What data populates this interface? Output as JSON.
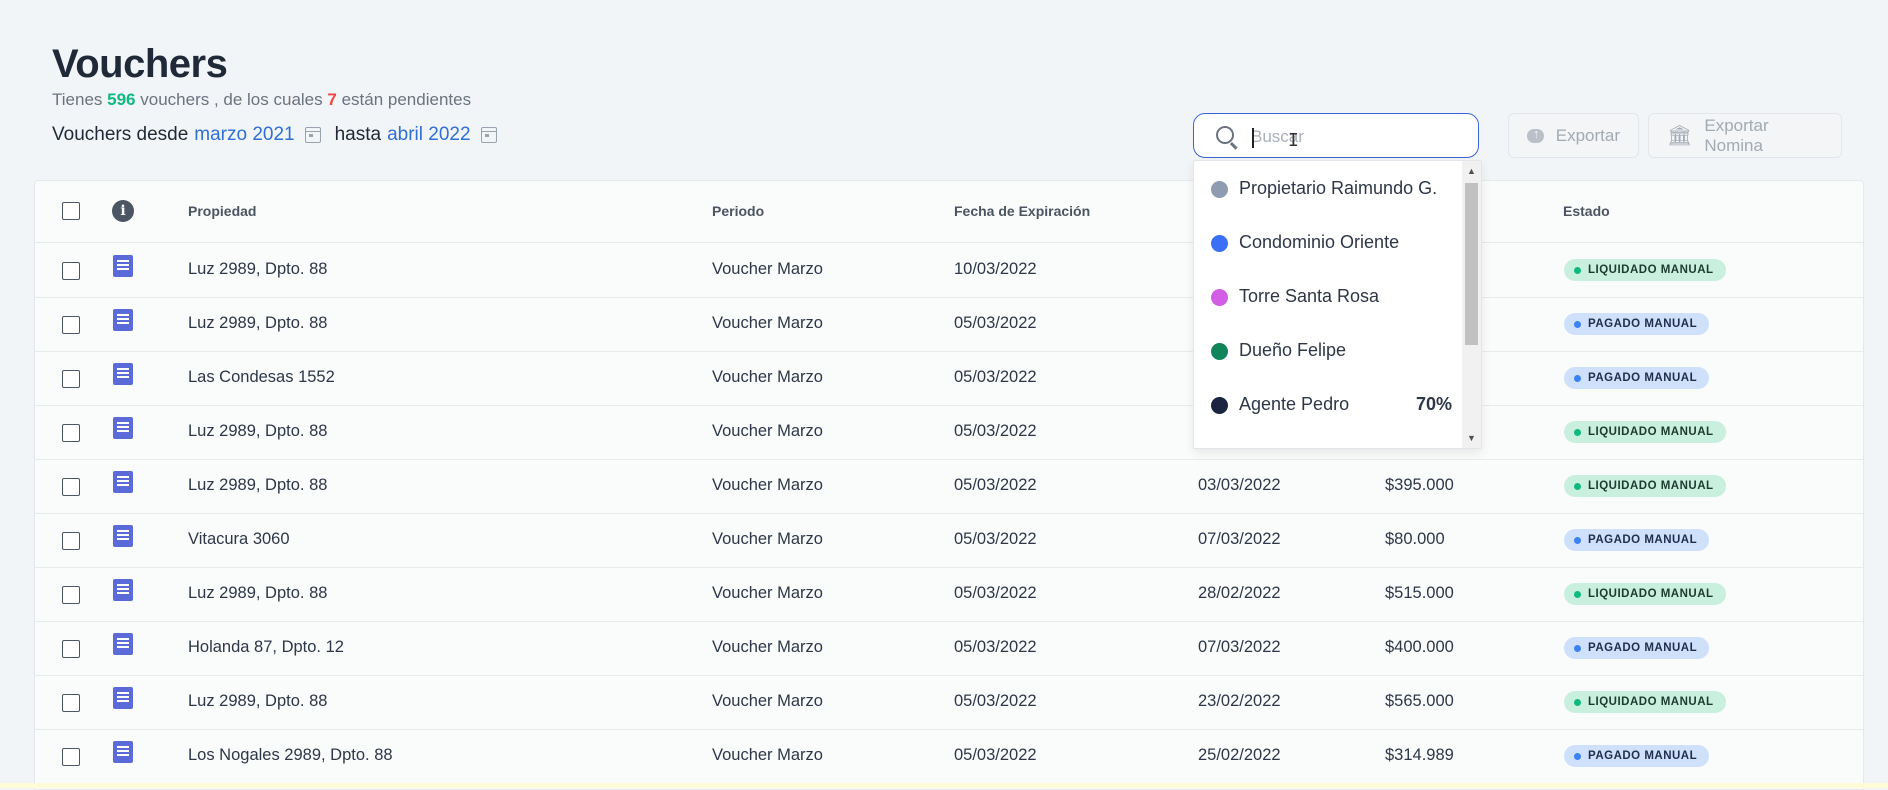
{
  "page": {
    "title": "Vouchers",
    "subtitle": {
      "prefix": "Tienes",
      "count": "596",
      "middle": "vouchers , de los cuales",
      "pending": "7",
      "suffix": "están pendientes"
    },
    "range": {
      "from_label": "Vouchers desde",
      "from": "marzo 2021",
      "to_label": "hasta",
      "to": "abril 2022"
    }
  },
  "search": {
    "placeholder": "Buscar",
    "value": ""
  },
  "buttons": {
    "export": "Exportar",
    "export_nomina": "Exportar Nomina"
  },
  "table": {
    "headers": [
      "Propiedad",
      "Periodo",
      "Fecha de Expiración",
      "",
      "",
      "Estado"
    ],
    "rows": [
      {
        "propiedad": "Luz 2989, Dpto. 88",
        "periodo": "Voucher Marzo",
        "expiracion": "10/03/2022",
        "fecha": "",
        "monto": "",
        "estado": "LIQUIDADO MANUAL",
        "estado_type": "liquidado"
      },
      {
        "propiedad": "Luz 2989, Dpto. 88",
        "periodo": "Voucher Marzo",
        "expiracion": "05/03/2022",
        "fecha": "",
        "monto": "",
        "estado": "PAGADO MANUAL",
        "estado_type": "pagado"
      },
      {
        "propiedad": "Las Condesas 1552",
        "periodo": "Voucher Marzo",
        "expiracion": "05/03/2022",
        "fecha": "",
        "monto": "",
        "estado": "PAGADO MANUAL",
        "estado_type": "pagado"
      },
      {
        "propiedad": "Luz 2989, Dpto. 88",
        "periodo": "Voucher Marzo",
        "expiracion": "05/03/2022",
        "fecha": "",
        "monto": "",
        "estado": "LIQUIDADO MANUAL",
        "estado_type": "liquidado"
      },
      {
        "propiedad": "Luz 2989, Dpto. 88",
        "periodo": "Voucher Marzo",
        "expiracion": "05/03/2022",
        "fecha": "03/03/2022",
        "monto": "$395.000",
        "estado": "LIQUIDADO MANUAL",
        "estado_type": "liquidado"
      },
      {
        "propiedad": "Vitacura 3060",
        "periodo": "Voucher Marzo",
        "expiracion": "05/03/2022",
        "fecha": "07/03/2022",
        "monto": "$80.000",
        "estado": "PAGADO MANUAL",
        "estado_type": "pagado"
      },
      {
        "propiedad": "Luz 2989, Dpto. 88",
        "periodo": "Voucher Marzo",
        "expiracion": "05/03/2022",
        "fecha": "28/02/2022",
        "monto": "$515.000",
        "estado": "LIQUIDADO MANUAL",
        "estado_type": "liquidado"
      },
      {
        "propiedad": "Holanda 87, Dpto. 12",
        "periodo": "Voucher Marzo",
        "expiracion": "05/03/2022",
        "fecha": "07/03/2022",
        "monto": "$400.000",
        "estado": "PAGADO MANUAL",
        "estado_type": "pagado"
      },
      {
        "propiedad": "Luz 2989, Dpto. 88",
        "periodo": "Voucher Marzo",
        "expiracion": "05/03/2022",
        "fecha": "23/02/2022",
        "monto": "$565.000",
        "estado": "LIQUIDADO MANUAL",
        "estado_type": "liquidado"
      },
      {
        "propiedad": "Los Nogales 2989, Dpto. 88",
        "periodo": "Voucher Marzo",
        "expiracion": "05/03/2022",
        "fecha": "25/02/2022",
        "monto": "$314.989",
        "estado": "PAGADO MANUAL",
        "estado_type": "pagado"
      }
    ]
  },
  "dropdown": {
    "items": [
      {
        "label": "Propietario Raimundo G.",
        "color": "#8e9bb0",
        "percent": ""
      },
      {
        "label": "Condominio Oriente",
        "color": "#3b6ff5",
        "percent": ""
      },
      {
        "label": "Torre Santa Rosa",
        "color": "#d25ee6",
        "percent": ""
      },
      {
        "label": "Dueño Felipe",
        "color": "#10855a",
        "percent": ""
      },
      {
        "label": "Agente Pedro",
        "color": "#1b2440",
        "percent": "70%"
      }
    ]
  },
  "colors": {
    "accent": "#3b63d8",
    "link": "#2f6fd6",
    "count_green": "#10b981",
    "pending_red": "#ef4444",
    "doc_icon": "#5b6ad9"
  }
}
